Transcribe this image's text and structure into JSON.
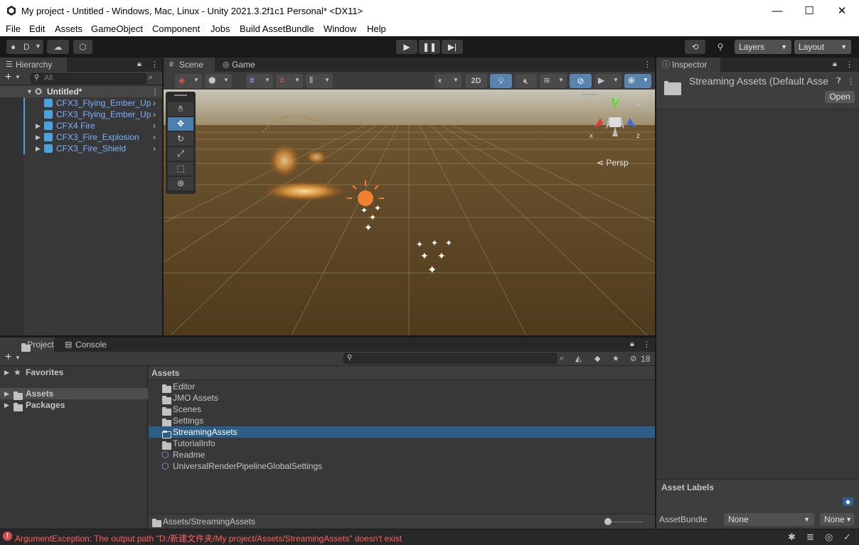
{
  "window": {
    "title": "My project - Untitled - Windows, Mac, Linux - Unity 2021.3.2f1c1 Personal* <DX11>",
    "minimize": "—",
    "maximize": "☐",
    "close": "✕"
  },
  "menu": [
    "File",
    "Edit",
    "Assets",
    "GameObject",
    "Component",
    "Jobs",
    "Build AssetBundle",
    "Window",
    "Help"
  ],
  "toolbar": {
    "account_label": "D",
    "layers_label": "Layers",
    "layout_label": "Layout"
  },
  "hierarchy": {
    "tab_label": "Hierarchy",
    "search_placeholder": "All",
    "scene_name": "Untitled*",
    "items": [
      {
        "label": "CFX3_Flying_Ember_Up"
      },
      {
        "label": "CFX3_Flying_Ember_Up"
      },
      {
        "label": "CFX4 Fire"
      },
      {
        "label": "CFX3_Fire_Explosion"
      },
      {
        "label": "CFX3_Fire_Shield"
      }
    ]
  },
  "scene": {
    "tab_scene": "Scene",
    "tab_game": "Game",
    "btn_2d": "2D",
    "persp_label": "Persp",
    "axis_x": "x",
    "axis_y": "y",
    "axis_z": "z"
  },
  "inspector": {
    "tab_label": "Inspector",
    "asset_title": "Streaming Assets (Default Asse",
    "open_button": "Open",
    "asset_labels_header": "Asset Labels",
    "assetbundle_label": "AssetBundle",
    "assetbundle_value": "None",
    "variant_value": "None"
  },
  "project": {
    "tab_project": "Project",
    "tab_console": "Console",
    "hidden_count": "18",
    "favorites_label": "Favorites",
    "tree": [
      {
        "label": "Assets"
      },
      {
        "label": "Packages"
      }
    ],
    "assets_header": "Assets",
    "files": [
      {
        "label": "Editor",
        "selected": false
      },
      {
        "label": "JMO Assets",
        "selected": false
      },
      {
        "label": "Scenes",
        "selected": false
      },
      {
        "label": "Settings",
        "selected": false
      },
      {
        "label": "StreamingAssets",
        "selected": true
      },
      {
        "label": "TutorialInfo",
        "selected": false
      },
      {
        "label": "Readme",
        "selected": false
      },
      {
        "label": "UniversalRenderPipelineGlobalSettings",
        "selected": false
      }
    ],
    "path": "Assets/StreamingAssets"
  },
  "status": {
    "error_text": "ArgumentException: The output path \"D:/新建文件夹/My project/Assets/StreamingAssets\" doesn't exist"
  },
  "colors": {
    "accent_selected": "#2c5d87",
    "error": "#ff5f5f",
    "link_blue": "#7bb0ff"
  }
}
